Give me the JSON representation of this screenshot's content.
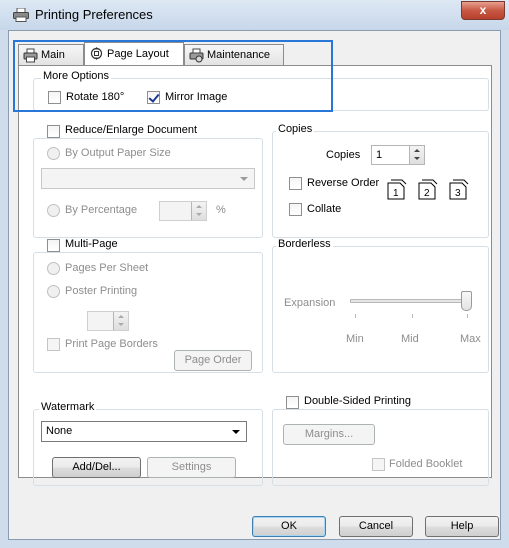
{
  "window": {
    "title": "Printing Preferences",
    "close_glyph": "x",
    "icon": "printer-icon"
  },
  "tabs": [
    {
      "label": "Main",
      "icon": "printer-icon",
      "active": false
    },
    {
      "label": "Page Layout",
      "icon": "page-layout-icon",
      "active": true
    },
    {
      "label": "Maintenance",
      "icon": "maintenance-icon",
      "active": false
    }
  ],
  "more_options": {
    "label": "More Options",
    "rotate_label": "Rotate 180°",
    "rotate_checked": false,
    "mirror_label": "Mirror Image",
    "mirror_checked": true
  },
  "reduce_enlarge": {
    "label": "Reduce/Enlarge Document",
    "checked": false,
    "by_output_label": "By Output Paper Size",
    "paper_size_value": "",
    "by_percentage_label": "By Percentage",
    "percentage_value": "",
    "percent_unit": "%"
  },
  "copies": {
    "label": "Copies",
    "copies_label": "Copies",
    "copies_value": "1",
    "reverse_order_label": "Reverse Order",
    "reverse_order_checked": false,
    "collate_label": "Collate",
    "collate_checked": false,
    "collate_icon": "collate-pages-icon",
    "page_numbers": [
      "1",
      "2",
      "3"
    ]
  },
  "multi_page": {
    "label": "Multi-Page",
    "checked": false,
    "pages_per_sheet_label": "Pages Per Sheet",
    "poster_printing_label": "Poster Printing",
    "spin_value": "",
    "print_borders_label": "Print Page Borders",
    "page_order_label": "Page Order"
  },
  "borderless": {
    "label": "Borderless",
    "expansion_label": "Expansion",
    "min_label": "Min",
    "mid_label": "Mid",
    "max_label": "Max",
    "level": 1.0
  },
  "watermark": {
    "label": "Watermark",
    "selected": "None",
    "add_del_label": "Add/Del...",
    "settings_label": "Settings"
  },
  "double_sided": {
    "label": "Double-Sided Printing",
    "checked": false,
    "margins_label": "Margins...",
    "folded_booklet_label": "Folded Booklet",
    "folded_booklet_checked": false
  },
  "footer": {
    "ok_label": "OK",
    "cancel_label": "Cancel",
    "help_label": "Help"
  },
  "colors": {
    "highlight": "#2876d8",
    "title_bar": "#cfdcec",
    "close_button": "#c75844"
  }
}
